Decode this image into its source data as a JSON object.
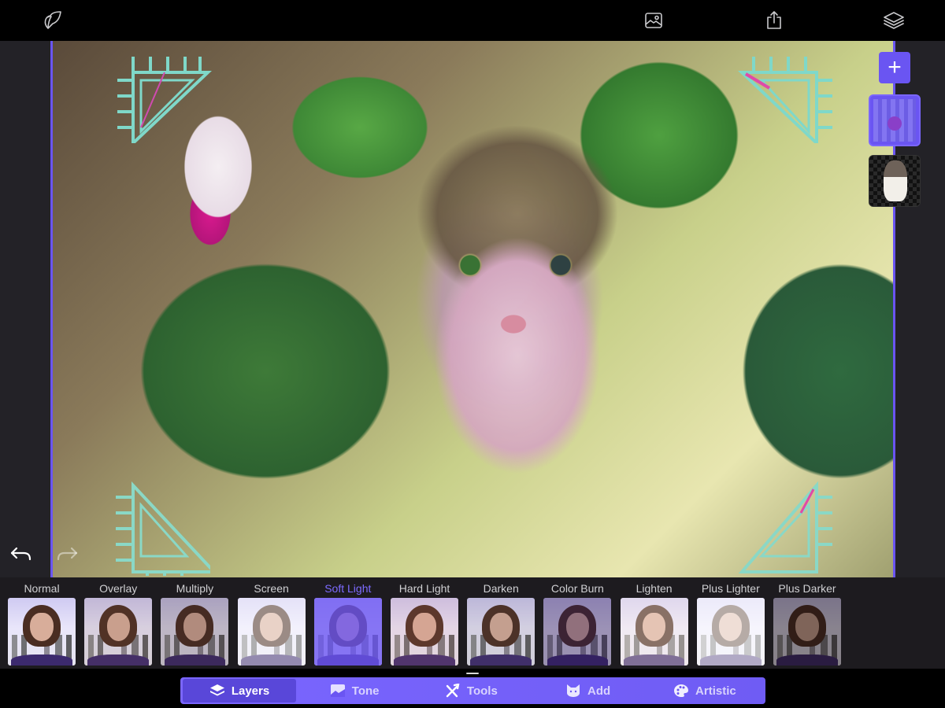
{
  "topbar": {
    "logo_icon": "leaf-logo-icon",
    "buttons": [
      {
        "name": "photo-library-button",
        "icon": "image-icon"
      },
      {
        "name": "share-button",
        "icon": "share-icon"
      },
      {
        "name": "layers-button",
        "icon": "layers-stack-icon"
      }
    ]
  },
  "canvas": {
    "description": "Composite of a tabby cat blended over fuchsia flower and leaves with Soft Light mode",
    "stickers": [
      "corner-frame-sticker-top-left",
      "corner-frame-sticker-top-right",
      "corner-frame-sticker-bottom-left",
      "corner-frame-sticker-bottom-right"
    ]
  },
  "layer_panel": {
    "add_label": "+",
    "layers": [
      {
        "name": "Sticker layer",
        "selected": true
      },
      {
        "name": "Cat layer",
        "selected": false
      }
    ]
  },
  "history": {
    "undo_enabled": true,
    "redo_enabled": false
  },
  "blend_modes": {
    "selected": "Soft Light",
    "items": [
      {
        "label": "Normal"
      },
      {
        "label": "Overlay"
      },
      {
        "label": "Multiply"
      },
      {
        "label": "Screen"
      },
      {
        "label": "Soft Light"
      },
      {
        "label": "Hard Light"
      },
      {
        "label": "Darken"
      },
      {
        "label": "Color Burn"
      },
      {
        "label": "Lighten"
      },
      {
        "label": "Plus Lighter"
      },
      {
        "label": "Plus Darker"
      }
    ]
  },
  "tabbar": {
    "tabs": [
      {
        "label": "Layers",
        "icon": "layers-icon",
        "active": true
      },
      {
        "label": "Tone",
        "icon": "tone-image-icon",
        "active": false
      },
      {
        "label": "Tools",
        "icon": "tools-icon",
        "active": false
      },
      {
        "label": "Add",
        "icon": "cat-face-icon",
        "active": false
      },
      {
        "label": "Artistic",
        "icon": "palette-icon",
        "active": false
      }
    ]
  },
  "colors": {
    "accent": "#6a55f2",
    "accent_active_label": "#7d6bff",
    "workspace_bg": "#232227",
    "strip_bg": "#1d1b1f"
  }
}
